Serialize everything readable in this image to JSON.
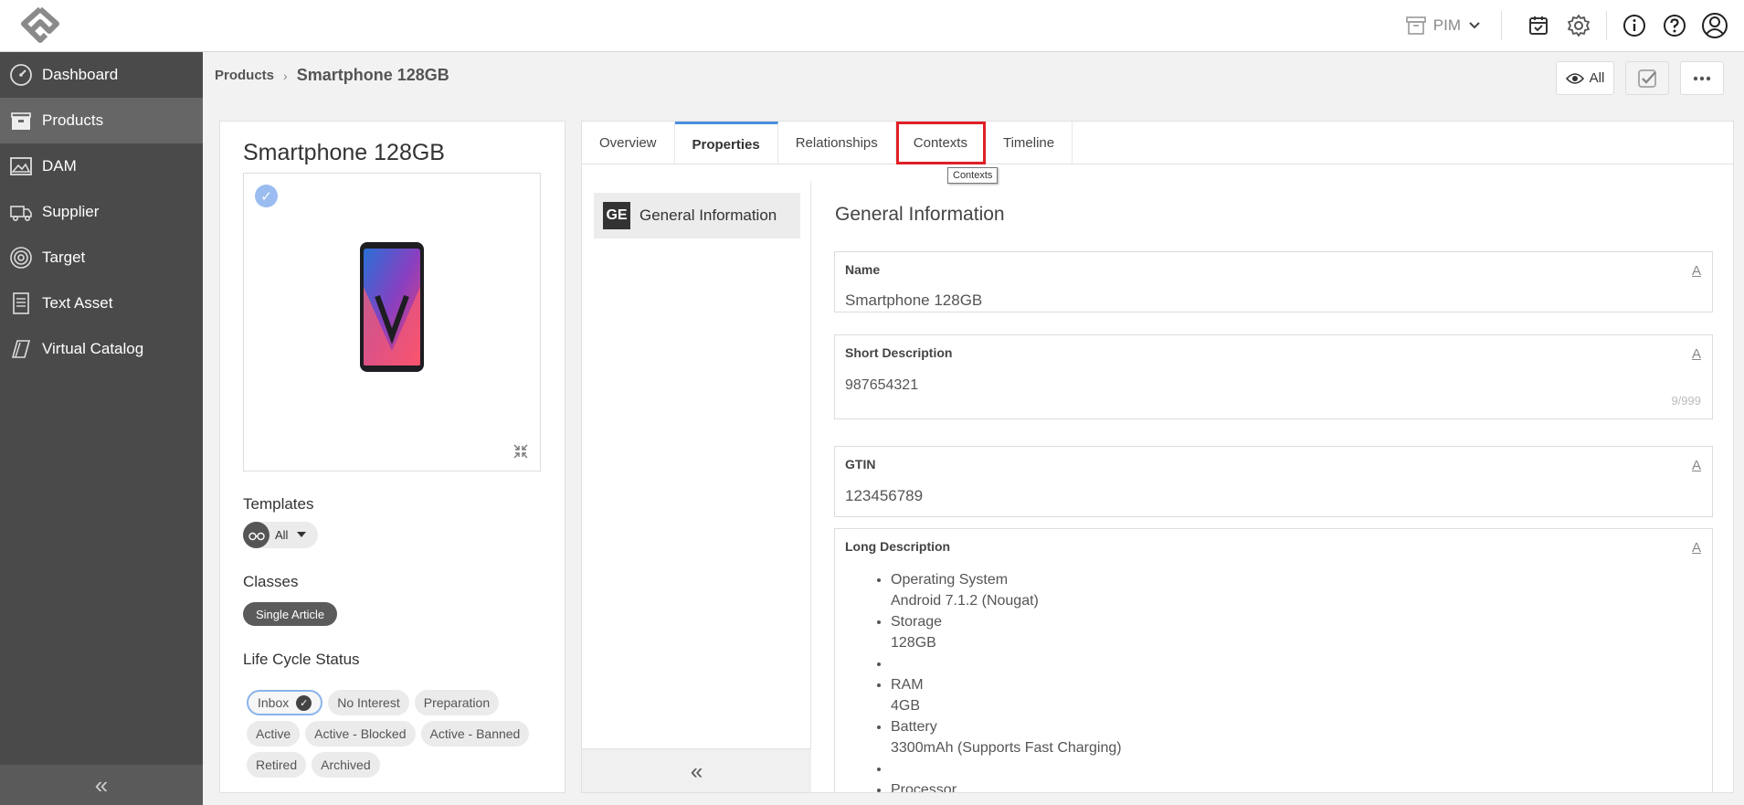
{
  "header": {
    "module": "PIM",
    "icons": [
      "calendar-check-icon",
      "gear-icon",
      "info-icon",
      "help-icon",
      "user-icon"
    ]
  },
  "sidebar": {
    "items": [
      {
        "label": "Dashboard",
        "icon": "dashboard-icon"
      },
      {
        "label": "Products",
        "icon": "products-icon",
        "active": true
      },
      {
        "label": "DAM",
        "icon": "image-icon"
      },
      {
        "label": "Supplier",
        "icon": "truck-icon"
      },
      {
        "label": "Target",
        "icon": "target-icon"
      },
      {
        "label": "Text Asset",
        "icon": "document-icon"
      },
      {
        "label": "Virtual Catalog",
        "icon": "catalog-icon"
      }
    ],
    "collapse_glyph": "«"
  },
  "breadcrumb": {
    "parent": "Products",
    "separator": "›",
    "current": "Smartphone 128GB"
  },
  "actions": {
    "view_label": "All"
  },
  "product": {
    "title": "Smartphone 128GB",
    "templates_label": "Templates",
    "template_value": "All",
    "classes_label": "Classes",
    "class_value": "Single Article",
    "lifecycle_label": "Life Cycle Status",
    "lifecycle_statuses": [
      {
        "label": "Inbox",
        "selected": true
      },
      {
        "label": "No Interest"
      },
      {
        "label": "Preparation"
      },
      {
        "label": "Active"
      },
      {
        "label": "Active - Blocked"
      },
      {
        "label": "Active - Banned"
      },
      {
        "label": "Retired"
      },
      {
        "label": "Archived"
      }
    ]
  },
  "tabs": [
    {
      "label": "Overview"
    },
    {
      "label": "Properties",
      "active": true
    },
    {
      "label": "Relationships"
    },
    {
      "label": "Contexts",
      "highlighted": true
    },
    {
      "label": "Timeline"
    }
  ],
  "tooltip": "Contexts",
  "sections": {
    "items": [
      {
        "abbr": "GE",
        "name": "General Information"
      }
    ],
    "collapse_glyph": "«"
  },
  "form": {
    "title": "General Information",
    "name_label": "Name",
    "name_value": "Smartphone 128GB",
    "short_desc_label": "Short Description",
    "short_desc_value": "987654321",
    "short_desc_counter": "9/999",
    "gtin_label": "GTIN",
    "gtin_value": "123456789",
    "long_desc_label": "Long Description",
    "long_desc_items": [
      "Operating System",
      "Android 7.1.2 (Nougat)",
      "Storage",
      "128GB",
      "",
      "RAM",
      "4GB",
      "Battery",
      "3300mAh (Supports Fast Charging)",
      "",
      "Processor"
    ],
    "attr_glyph": "A"
  },
  "colors": {
    "sidebar": "#4a4a4a",
    "sidebar_active": "#666666",
    "accent_tab": "#4a8fe0",
    "highlight": "#e01f26",
    "checkbadge": "#9bbcf0"
  }
}
